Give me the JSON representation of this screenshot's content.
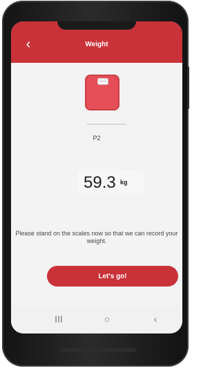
{
  "app": {
    "title": "Weight"
  },
  "profile": {
    "label": "P2"
  },
  "reading": {
    "value": "59.3",
    "unit": "kg"
  },
  "instruction": {
    "text": "Please stand on the scales now so that we can record your weight."
  },
  "actions": {
    "primary_label": "Let's go!"
  },
  "navigation": {
    "back_icon": "‹",
    "recent_icon": "III",
    "home_icon": "○",
    "system_back_icon": "‹"
  },
  "theme": {
    "accent": "#c93239",
    "background": "#f3f3f3"
  }
}
